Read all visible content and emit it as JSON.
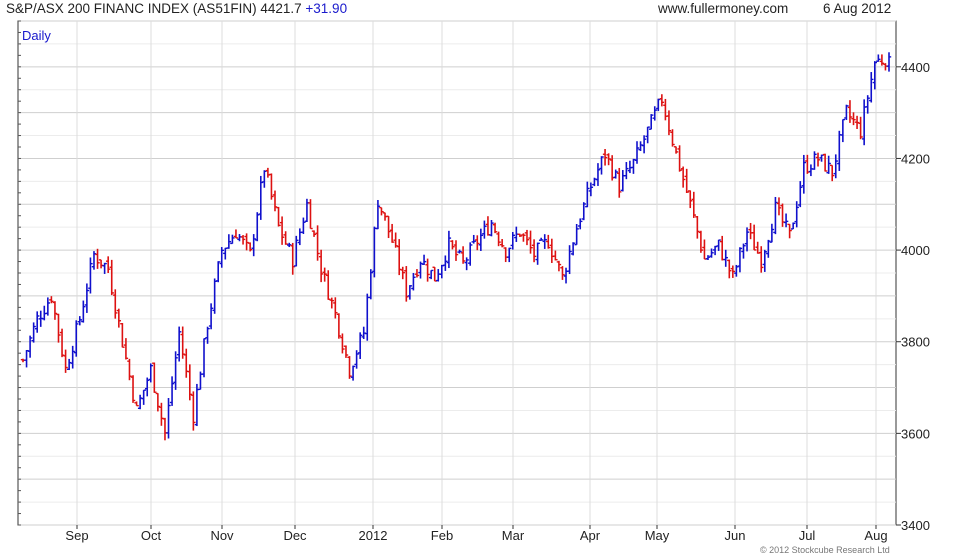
{
  "header": {
    "index_name": "S&P/ASX 200 FINANC INDEX (AS51FIN)",
    "last_value": "4421.7",
    "change": "+31.90",
    "website": "www.fullermoney.com",
    "date": "6 Aug 2012"
  },
  "footer": {
    "copyright": "© 2012 Stockcube Research Ltd"
  },
  "chart_data": {
    "type": "bar",
    "subtype": "ohlc",
    "periodicity": "Daily",
    "ylim": [
      3400,
      4500
    ],
    "yticks": [
      "3400",
      "3600",
      "3800",
      "4000",
      "4200",
      "4400"
    ],
    "xticks": [
      "Sep",
      "Oct",
      "Nov",
      "Dec",
      "2012",
      "Feb",
      "Mar",
      "Apr",
      "May",
      "Jun",
      "Jul",
      "Aug"
    ],
    "grid": true,
    "y_axis_side": "right",
    "colors": {
      "up": "#1010cc",
      "down": "#dd1111",
      "grid": "#d8d8d8",
      "axis": "#333333"
    },
    "anchors": [
      {
        "tick": "Sep",
        "close": 3760
      },
      {
        "tick": "Sep",
        "close": 3850
      },
      {
        "tick": "Sep",
        "close": 3900
      },
      {
        "tick": "Sep",
        "close": 3740
      },
      {
        "tick": "Sep",
        "close": 3850
      },
      {
        "tick": "Sep",
        "close": 3990
      },
      {
        "tick": "Sep",
        "close": 3960
      },
      {
        "tick": "Sep",
        "close": 3800
      },
      {
        "tick": "Sep",
        "close": 3650
      },
      {
        "tick": "Oct",
        "close": 3740
      },
      {
        "tick": "Oct",
        "close": 3600
      },
      {
        "tick": "Oct",
        "close": 3820
      },
      {
        "tick": "Oct",
        "close": 3640
      },
      {
        "tick": "Oct",
        "close": 3840
      },
      {
        "tick": "Oct",
        "close": 4000
      },
      {
        "tick": "Oct",
        "close": 4040
      },
      {
        "tick": "Nov",
        "close": 3990
      },
      {
        "tick": "Nov",
        "close": 4180
      },
      {
        "tick": "Nov",
        "close": 4050
      },
      {
        "tick": "Nov",
        "close": 3980
      },
      {
        "tick": "Nov",
        "close": 4100
      },
      {
        "tick": "Nov",
        "close": 3960
      },
      {
        "tick": "Nov",
        "close": 3860
      },
      {
        "tick": "Nov",
        "close": 3740
      },
      {
        "tick": "Dec",
        "close": 3820
      },
      {
        "tick": "Dec",
        "close": 4110
      },
      {
        "tick": "Dec",
        "close": 4020
      },
      {
        "tick": "Dec",
        "close": 3910
      },
      {
        "tick": "Dec",
        "close": 3980
      },
      {
        "tick": "2012",
        "close": 3940
      },
      {
        "tick": "2012",
        "close": 4010
      },
      {
        "tick": "2012",
        "close": 3970
      },
      {
        "tick": "2012",
        "close": 4020
      },
      {
        "tick": "Feb",
        "close": 4060
      },
      {
        "tick": "Feb",
        "close": 4000
      },
      {
        "tick": "Feb",
        "close": 4040
      },
      {
        "tick": "Feb",
        "close": 3990
      },
      {
        "tick": "Mar",
        "close": 4020
      },
      {
        "tick": "Mar",
        "close": 3940
      },
      {
        "tick": "Mar",
        "close": 4050
      },
      {
        "tick": "Mar",
        "close": 4140
      },
      {
        "tick": "Apr",
        "close": 4210
      },
      {
        "tick": "Apr",
        "close": 4140
      },
      {
        "tick": "Apr",
        "close": 4190
      },
      {
        "tick": "Apr",
        "close": 4260
      },
      {
        "tick": "May",
        "close": 4330
      },
      {
        "tick": "May",
        "close": 4210
      },
      {
        "tick": "May",
        "close": 4100
      },
      {
        "tick": "May",
        "close": 3980
      },
      {
        "tick": "May",
        "close": 4010
      },
      {
        "tick": "Jun",
        "close": 3940
      },
      {
        "tick": "Jun",
        "close": 4040
      },
      {
        "tick": "Jun",
        "close": 3980
      },
      {
        "tick": "Jun",
        "close": 4090
      },
      {
        "tick": "Jun",
        "close": 4030
      },
      {
        "tick": "Jul",
        "close": 4180
      },
      {
        "tick": "Jul",
        "close": 4200
      },
      {
        "tick": "Jul",
        "close": 4170
      },
      {
        "tick": "Jul",
        "close": 4300
      },
      {
        "tick": "Jul",
        "close": 4260
      },
      {
        "tick": "Aug",
        "close": 4410
      },
      {
        "tick": "Aug",
        "close": 4421.7
      }
    ]
  }
}
